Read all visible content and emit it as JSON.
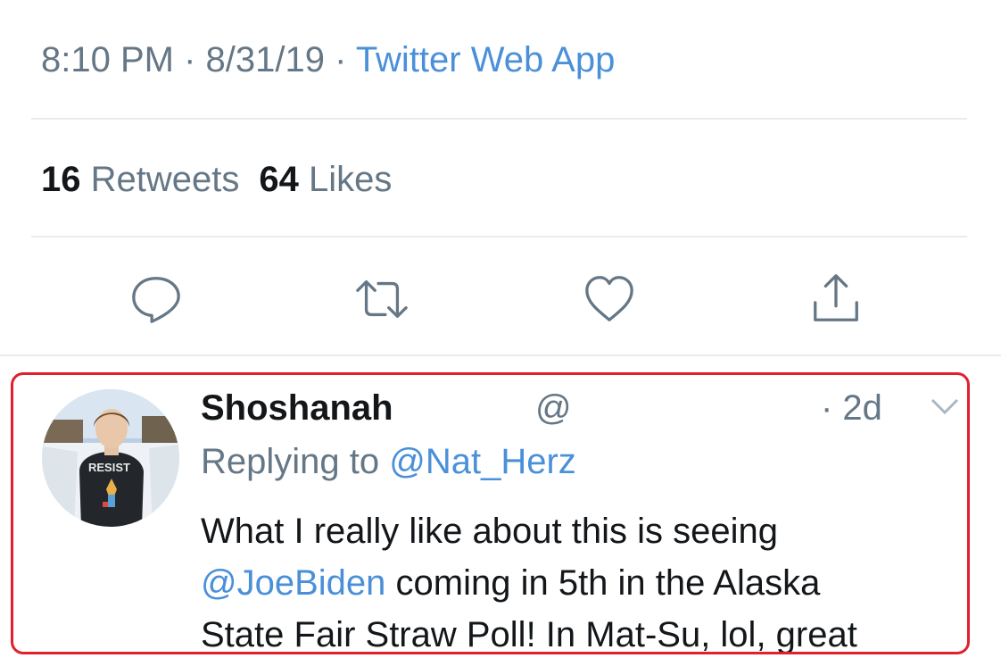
{
  "tweet_meta": {
    "time": "8:10 PM",
    "separator": " · ",
    "date": "8/31/19",
    "source": "Twitter Web App"
  },
  "stats": {
    "retweets_count": "16",
    "retweets_label": "Retweets",
    "likes_count": "64",
    "likes_label": "Likes"
  },
  "actions": [
    {
      "icon": "reply-icon"
    },
    {
      "icon": "retweet-icon"
    },
    {
      "icon": "like-icon"
    },
    {
      "icon": "share-icon"
    }
  ],
  "reply": {
    "author_name": "Shoshanah",
    "handle": "@",
    "time": "· 2d",
    "replying_prefix": "Replying to ",
    "replying_to": "@Nat_Herz",
    "avatar_shirt_text": "RESIST",
    "body": {
      "line1": "What I really like about this is seeing",
      "mention": "@JoeBiden",
      "line2_rest": " coming in 5th in the Alaska",
      "line3": "State Fair Straw Poll! In Mat-Su, lol, great"
    }
  },
  "colors": {
    "link": "#4a90d9",
    "muted": "#657786",
    "highlight_border": "#e0202c"
  }
}
